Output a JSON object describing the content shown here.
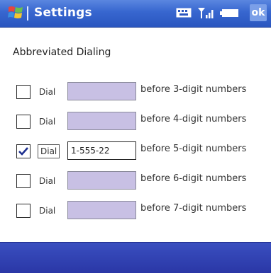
{
  "window": {
    "title": "Settings",
    "ok_label": "ok"
  },
  "status_icons": [
    "keyboard-icon",
    "signal-strength-icon",
    "battery-icon"
  ],
  "section": {
    "heading": "Abbreviated Dialing"
  },
  "rows": [
    {
      "checked": false,
      "dial_label": "Dial",
      "prefix_value": "",
      "suffix": "before 3-digit numbers"
    },
    {
      "checked": false,
      "dial_label": "Dial",
      "prefix_value": "",
      "suffix": "before 4-digit numbers"
    },
    {
      "checked": true,
      "dial_label": "Dial",
      "prefix_value": "1-555-22",
      "suffix": "before 5-digit numbers"
    },
    {
      "checked": false,
      "dial_label": "Dial",
      "prefix_value": "",
      "suffix": "before 6-digit numbers"
    },
    {
      "checked": false,
      "dial_label": "Dial",
      "prefix_value": "",
      "suffix": "before 7-digit numbers"
    }
  ],
  "colors": {
    "title_bar": "#3766cf",
    "menu_bar": "#2a37a6",
    "inactive_input": "#c8c0e4"
  }
}
